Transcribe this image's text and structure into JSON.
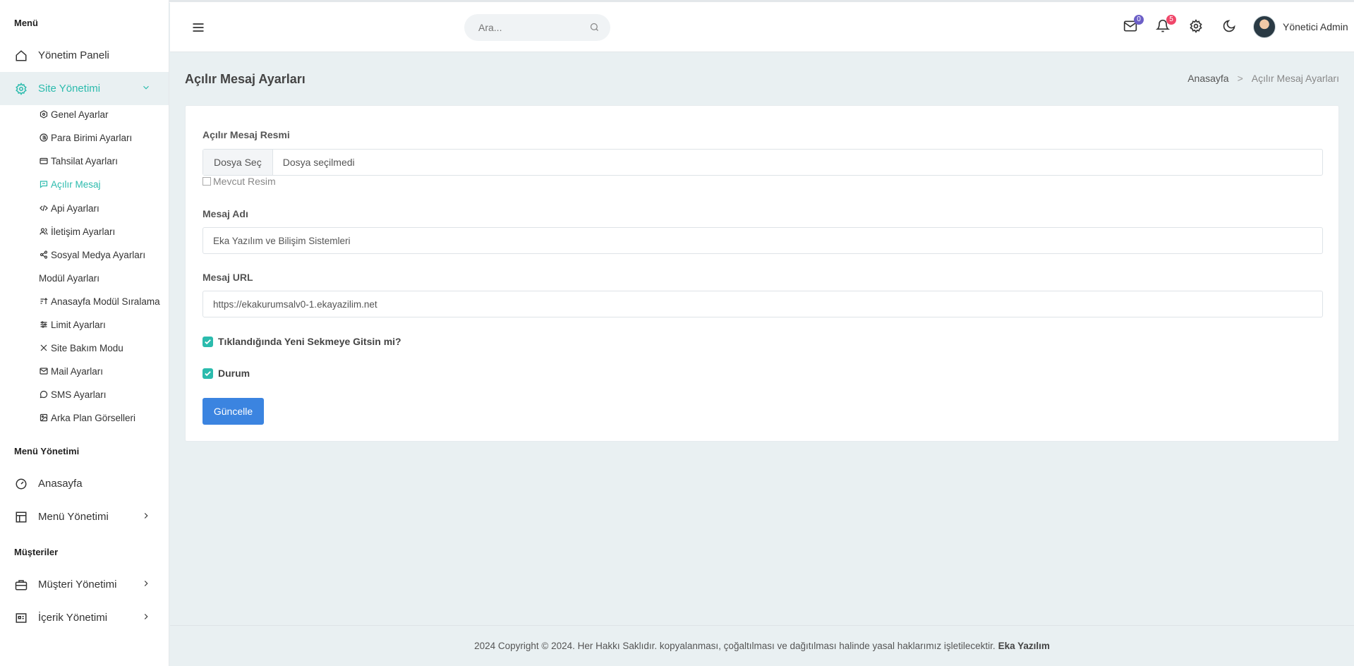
{
  "sidebar": {
    "section_menu": "Menü",
    "dashboard": "Yönetim Paneli",
    "site_management": "Site Yönetimi",
    "sub_items": [
      {
        "label": "Genel Ayarlar",
        "icon": "hexagon-gear-icon"
      },
      {
        "label": "Para Birimi Ayarları",
        "icon": "currency-icon"
      },
      {
        "label": "Tahsilat Ayarları",
        "icon": "wallet-icon"
      },
      {
        "label": "Açılır Mesaj",
        "icon": "message-icon",
        "active": true
      },
      {
        "label": "Api Ayarları",
        "icon": "code-icon"
      },
      {
        "label": "İletişim Ayarları",
        "icon": "users-icon"
      },
      {
        "label": "Sosyal Medya Ayarları",
        "icon": "share-icon"
      },
      {
        "label": "Modül Ayarları",
        "icon": ""
      },
      {
        "label": "Anasayfa Modül Sıralama",
        "icon": "sort-icon"
      },
      {
        "label": "Limit Ayarları",
        "icon": "sliders-icon"
      },
      {
        "label": "Site Bakım Modu",
        "icon": "tools-icon"
      },
      {
        "label": "Mail Ayarları",
        "icon": "mail-icon"
      },
      {
        "label": "SMS Ayarları",
        "icon": "chat-icon"
      },
      {
        "label": "Arka Plan Görselleri",
        "icon": "image-icon"
      }
    ],
    "section_menu_management": "Menü Yönetimi",
    "homepage": "Anasayfa",
    "menu_management": "Menü Yönetimi",
    "section_customers": "Müşteriler",
    "customer_management": "Müşteri Yönetimi",
    "content_management": "İçerik Yönetimi"
  },
  "header": {
    "search_placeholder": "Ara...",
    "mail_count": "0",
    "notification_count": "5",
    "user_name": "Yönetici Admin"
  },
  "page": {
    "title": "Açılır Mesaj Ayarları",
    "breadcrumb": [
      "Anasayfa",
      "Açılır Mesaj Ayarları"
    ],
    "breadcrumb_sep": ">"
  },
  "form": {
    "image_label": "Açılır Mesaj Resmi",
    "file_button": "Dosya Seç",
    "file_status": "Dosya seçilmedi",
    "current_image_alt": "Mevcut Resim",
    "name_label": "Mesaj Adı",
    "name_value": "Eka Yazılım ve Bilişim Sistemleri",
    "url_label": "Mesaj URL",
    "url_value": "https://ekakurumsalv0-1.ekayazilim.net",
    "new_tab_label": "Tıklandığında Yeni Sekmeye Gitsin mi?",
    "new_tab_checked": true,
    "status_label": "Durum",
    "status_checked": true,
    "submit": "Güncelle"
  },
  "footer": {
    "text": "2024 Copyright © 2024. Her Hakkı Saklıdır. kopyalanması, çoğaltılması ve dağıtılması halinde yasal haklarımız işletilecektir.",
    "brand": "Eka Yazılım"
  },
  "colors": {
    "accent": "#2bbbad",
    "primary_button": "#3b84e0",
    "mail_badge": "#6c5fc7",
    "notification_badge": "#f0476a",
    "background": "#e9f0f2"
  }
}
